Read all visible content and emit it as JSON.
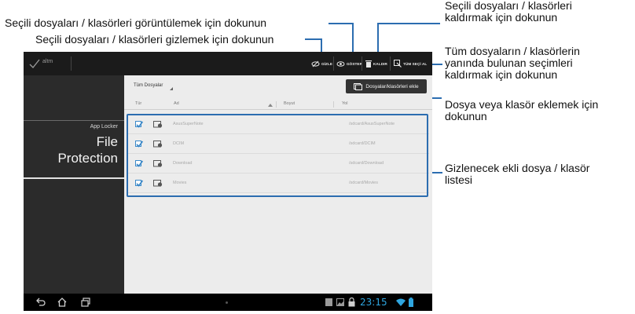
{
  "callouts": {
    "show_selected": "Seçili dosyaları / klasörleri görüntülemek için dokunun",
    "hide_selected": "Seçili dosyaları / klasörleri gizlemek için dokunun",
    "remove_selected_l1": "Seçili dosyaları / klasörleri",
    "remove_selected_l2": "kaldırmak için dokunun",
    "deselect_all_l1": "Tüm dosyaların / klasörlerin",
    "deselect_all_l2": "yanında bulunan seçimleri",
    "deselect_all_l3": "kaldırmak için dokunun",
    "add_l1": "Dosya veya klasör eklemek için",
    "add_l2": "dokunun",
    "list_l1": "Gizlenecek ekli dosya / klasör",
    "list_l2": "listesi"
  },
  "action_bar": {
    "done_label": "altm",
    "hide_label": "GİZLE",
    "show_label": "GÖSTER",
    "remove_label": "KALDIR",
    "deselect_all_label": "TÜM SEÇİ AL"
  },
  "sidebar": {
    "subtitle": "App Locker",
    "title_line1": "File",
    "title_line2": "Protection"
  },
  "content": {
    "filter_label": "Tüm Dosyalar",
    "add_button_label": "Dosyalar/klasörleri ekle",
    "columns": {
      "type": "Tür",
      "name": "Ad",
      "size": "Boyut",
      "path": "Yol"
    },
    "rows": [
      {
        "name": "AsusSuperNote",
        "path": "/sdcard/AsusSuperNote",
        "checked": true
      },
      {
        "name": "DCIM",
        "path": "/sdcard/DCIM",
        "checked": true
      },
      {
        "name": "Download",
        "path": "/sdcard/Download",
        "checked": true
      },
      {
        "name": "Movies",
        "path": "/sdcard/Movies",
        "checked": true
      }
    ]
  },
  "status_bar": {
    "clock": "23:15"
  },
  "colors": {
    "accent": "#2c6db0",
    "clock": "#2fa6e0"
  },
  "icons": [
    "checkmark-icon",
    "hide-eye-icon",
    "eye-icon",
    "trash-icon",
    "select-off-icon",
    "add-folder-icon",
    "folder-lock-icon",
    "back-icon",
    "home-icon",
    "recents-icon",
    "wifi-icon",
    "battery-icon",
    "lock-icon"
  ]
}
